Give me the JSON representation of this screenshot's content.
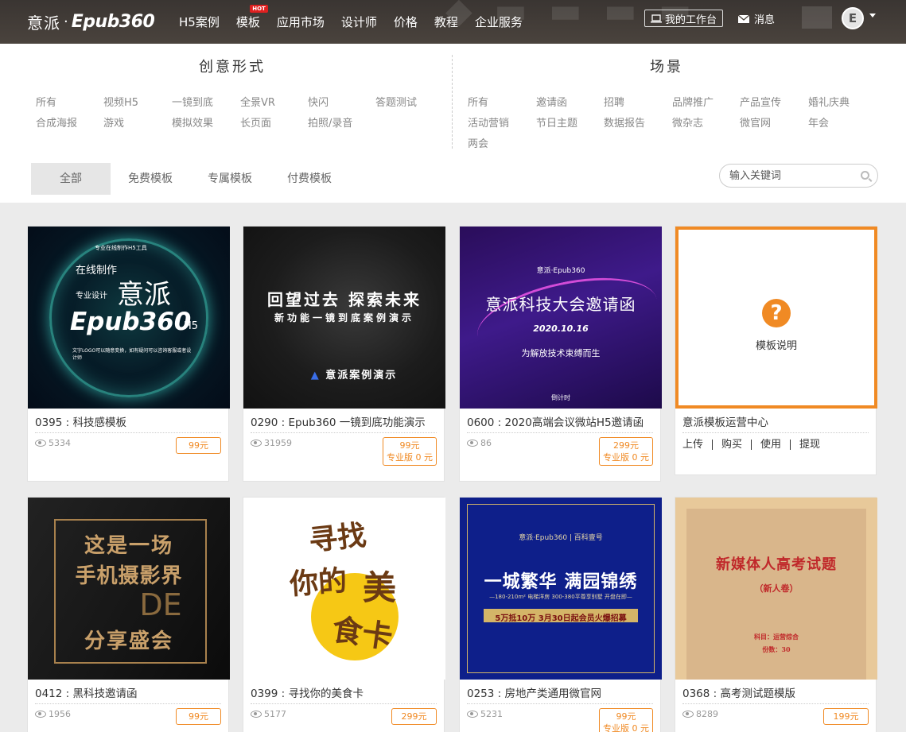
{
  "header": {
    "logo_cn": "意派",
    "logo_dot": "·",
    "logo_en": "Epub360",
    "nav": [
      {
        "label": "H5案例",
        "hot": ""
      },
      {
        "label": "模板",
        "hot": "HOT"
      },
      {
        "label": "应用市场",
        "hot": ""
      },
      {
        "label": "设计师",
        "hot": ""
      },
      {
        "label": "价格",
        "hot": ""
      },
      {
        "label": "教程",
        "hot": ""
      },
      {
        "label": "企业服务",
        "hot": ""
      }
    ],
    "workbench_label": "我的工作台",
    "message_label": "消息",
    "avatar_letter": "E"
  },
  "filters": {
    "form_title": "创意形式",
    "scene_title": "场景",
    "forms": [
      "所有",
      "视频H5",
      "一镜到底",
      "全景VR",
      "快闪",
      "答题测试",
      "合成海报",
      "游戏",
      "模拟效果",
      "长页面",
      "拍照/录音"
    ],
    "scenes": [
      "所有",
      "邀请函",
      "招聘",
      "品牌推广",
      "产品宣传",
      "婚礼庆典",
      "活动营销",
      "节日主题",
      "数据报告",
      "微杂志",
      "微官网",
      "年会",
      "两会"
    ]
  },
  "tabs": [
    "全部",
    "免费模板",
    "专属模板",
    "付费模板"
  ],
  "search": {
    "placeholder": "输入关键词"
  },
  "cards": [
    {
      "title": "0395 : 科技感模板",
      "views": "5334",
      "price": "99元",
      "pro": ""
    },
    {
      "title": "0290 : Epub360 一镜到底功能演示",
      "views": "31959",
      "price": "99元",
      "pro": "专业版 0 元"
    },
    {
      "title": "0600 : 2020高端会议微站H5邀请函",
      "views": "86",
      "price": "299元",
      "pro": "专业版 0 元"
    },
    {
      "title": "意派模板运营中心",
      "help_label": "模板说明",
      "links": [
        "上传",
        "购买",
        "使用",
        "提现"
      ]
    },
    {
      "title": "0412 : 黑科技邀请函",
      "views": "1956",
      "price": "99元",
      "pro": ""
    },
    {
      "title": "0399 : 寻找你的美食卡",
      "views": "5177",
      "price": "299元",
      "pro": ""
    },
    {
      "title": "0253 : 房地产类通用微官网",
      "views": "5231",
      "price": "99元",
      "pro": "专业版 0 元"
    },
    {
      "title": "0368 : 高考测试题模版",
      "views": "8289",
      "price": "199元",
      "pro": ""
    }
  ],
  "thumbs": {
    "t1": {
      "l1": "专业在线制作H5工具",
      "l2": "在线制作",
      "l3": "专业设计",
      "l4": "意派",
      "l5": "Epub360",
      "l6": "H5",
      "l7": "文字LOGO可以随意变换，如有疑问可以咨询客服或者设计师"
    },
    "t2": {
      "l1": "回望过去 探索未来",
      "l2": "新功能一镜到底案例演示",
      "l3": "意派案例演示"
    },
    "t3": {
      "l1": "意派·Epub360",
      "l2": "意派科技大会邀请函",
      "l3": "2020.10.16",
      "l4": "为解放技术束缚而生",
      "l5": "倒计时"
    },
    "t5": {
      "l1": "这是一场",
      "l2": "手机摄影界",
      "l3": "DE",
      "l4": "分享盛会"
    },
    "t6": {
      "l1": "寻找",
      "l2": "你的",
      "l3": "美",
      "l4": "食卡"
    },
    "t7": {
      "l1": "意派·Epub360 | 百科壹号",
      "l2": "一城繁华 满园锦绣",
      "l3": "—180-210m² 电梯洋房 300-380平尊享别墅 开盘在即—",
      "l4": "5万抵10万 3月30日起会员火爆招募"
    },
    "t8": {
      "l1": "新媒体人高考试题",
      "l2": "（新人卷）",
      "l3": "科目：运营综合",
      "l4": "份数：30"
    }
  }
}
